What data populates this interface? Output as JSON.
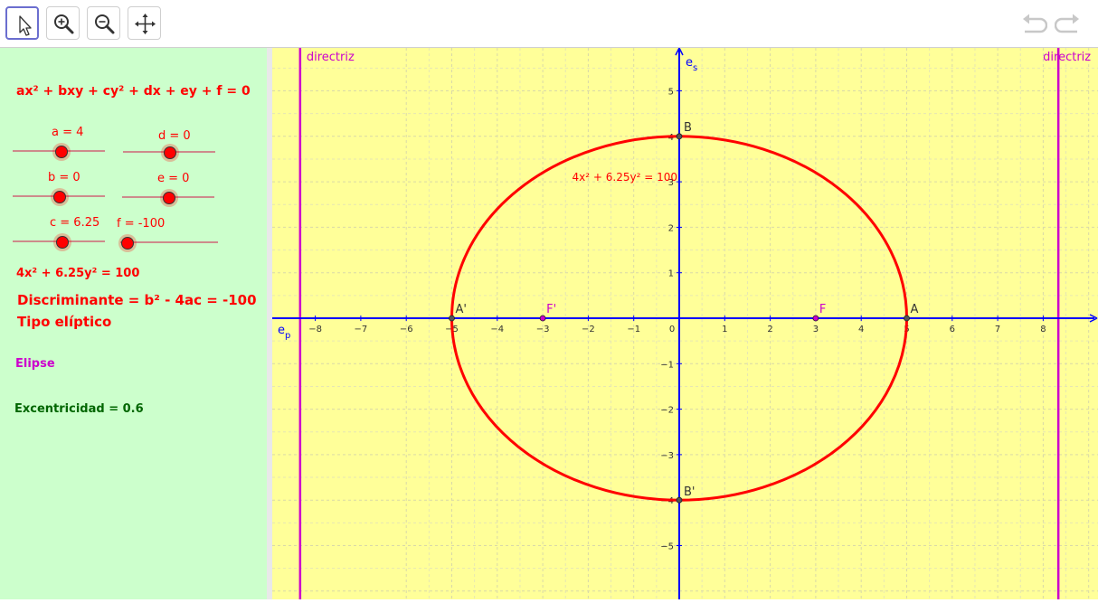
{
  "toolbar": {
    "tools": [
      "move-tool",
      "zoom-in-tool",
      "zoom-out-tool",
      "move-graphics-tool"
    ]
  },
  "algebra": {
    "general_equation": "ax² + bxy + cy² + dx + ey + f = 0",
    "sliders": {
      "a": {
        "label": "a = 4",
        "value": 4
      },
      "b": {
        "label": "b = 0",
        "value": 0
      },
      "c": {
        "label": "c = 6.25",
        "value": 6.25
      },
      "d": {
        "label": "d = 0",
        "value": 0
      },
      "e": {
        "label": "e = 0",
        "value": 0
      },
      "f": {
        "label": "f = -100",
        "value": -100
      }
    },
    "equation": "4x² + 6.25y² = 100",
    "discriminant": "Discriminante = b² - 4ac = -100",
    "type": "Tipo elíptico",
    "conic_name": "Elipse",
    "eccentricity": "Excentricidad = 0.6"
  },
  "graphics": {
    "x_axis_label": "e",
    "x_axis_sub": "p",
    "y_axis_label": "e",
    "y_axis_sub": "s",
    "directrix_label": "directriz",
    "curve_label": "4x² + 6.25y² = 100",
    "points": [
      {
        "name": "A",
        "x": 5,
        "y": 0
      },
      {
        "name": "A'",
        "x": -5,
        "y": 0
      },
      {
        "name": "B",
        "x": 0,
        "y": 4
      },
      {
        "name": "B'",
        "x": 0,
        "y": -4
      },
      {
        "name": "F",
        "x": 3,
        "y": 0
      },
      {
        "name": "F'",
        "x": -3,
        "y": 0
      }
    ],
    "ellipse": {
      "a": 5,
      "b": 4
    },
    "directrices": [
      -8.3333,
      8.3333
    ],
    "x_ticks": [
      "−8",
      "−7",
      "−6",
      "−5",
      "−4",
      "−3",
      "−2",
      "−1",
      "0",
      "1",
      "2",
      "3",
      "4",
      "5",
      "6",
      "7",
      "8"
    ],
    "y_ticks": [
      "5",
      "4",
      "3",
      "2",
      "1",
      "−1",
      "−2",
      "−3",
      "−4",
      "−5"
    ],
    "colors": {
      "background": "#ffff99",
      "axes": "#0000ff",
      "ellipse": "#ff0000",
      "directrix": "#cc00cc",
      "focus": "#cc00cc",
      "point": "#333333"
    }
  }
}
